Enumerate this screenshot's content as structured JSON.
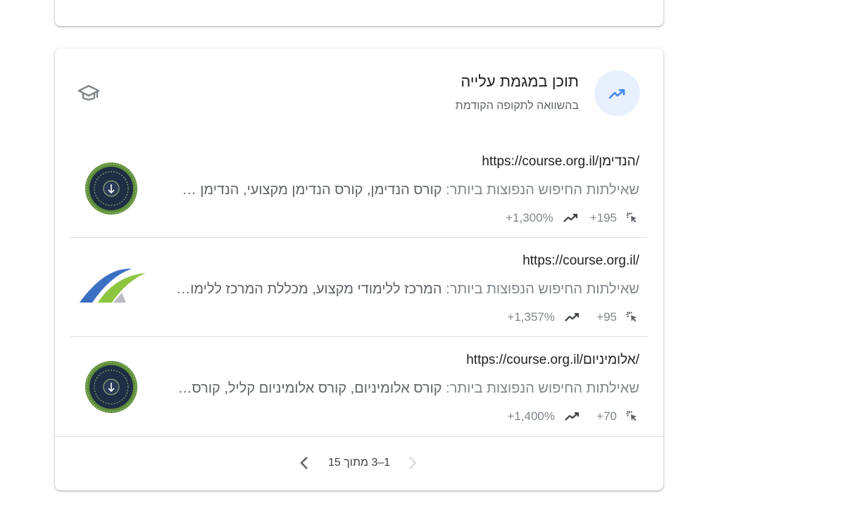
{
  "card": {
    "title": "תוכן במגמת עלייה",
    "subtitle": "בהשוואה לתקופה הקודמת",
    "header_icon": "trending-up-icon",
    "side_icon": "graduation-cap-icon",
    "accent_color": "#4285f4",
    "accent_bg": "#e8f0fe"
  },
  "queries_label": "שאילתות החיפוש הנפוצות ביותר:",
  "rows": [
    {
      "url": "https://course.org.il/הנדימן/",
      "queries": "קורס הנדימן, קורס הנדימן מקצועי, הנדימן קורס",
      "clicks": "+195",
      "change": "+1,300%",
      "logo": "college-seal-logo"
    },
    {
      "url": "https://course.org.il/",
      "queries": "המרכז ללימודי מקצוע, מכללת המרכז ללימודי מקצוע",
      "clicks": "+95",
      "change": "+1,357%",
      "logo": "swoosh-logo"
    },
    {
      "url": "https://course.org.il/אלומיניום/",
      "queries": "קורס אלומיניום, קורס אלומיניום קליל, קורס אלומיניום",
      "clicks": "+70",
      "change": "+1,400%",
      "logo": "college-seal-logo"
    }
  ],
  "pagination": {
    "range": "1–3 מתוך 15"
  }
}
